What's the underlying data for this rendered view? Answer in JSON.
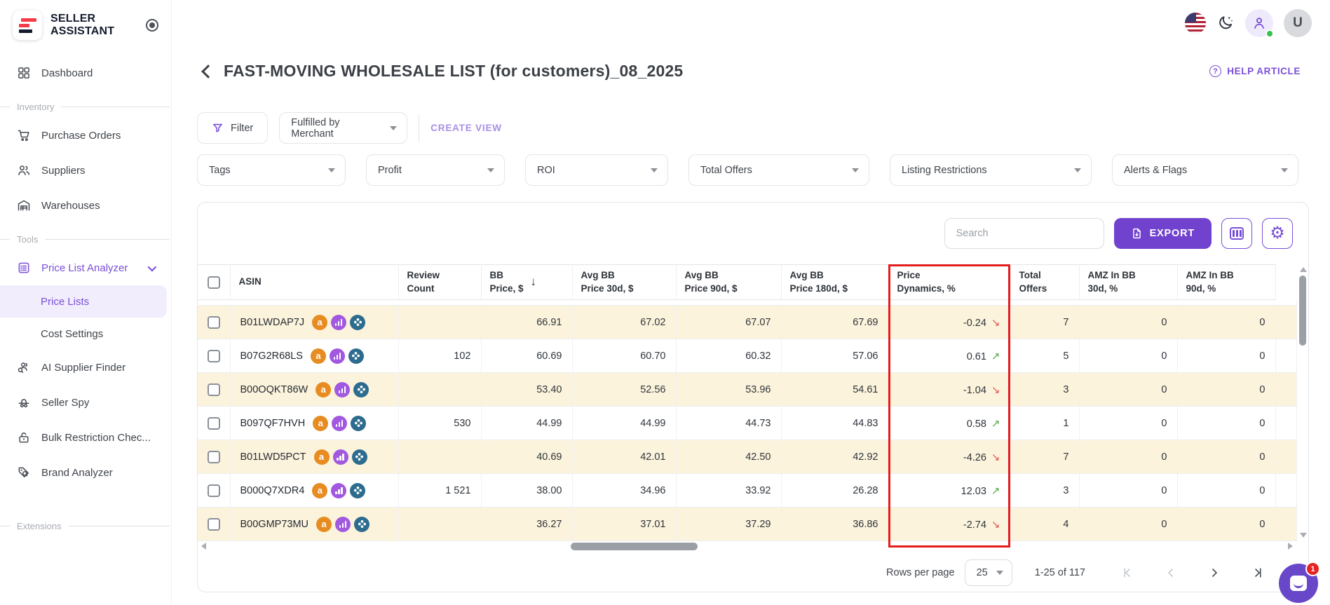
{
  "brand": {
    "line1": "SELLER",
    "line2": "ASSISTANT"
  },
  "topbar": {
    "avatar_letter": "U"
  },
  "sidebar": {
    "dashboard_label": "Dashboard",
    "inventory_label": "Inventory",
    "purchase_orders_label": "Purchase Orders",
    "suppliers_label": "Suppliers",
    "warehouses_label": "Warehouses",
    "tools_label": "Tools",
    "price_list_analyzer_label": "Price List Analyzer",
    "price_lists_label": "Price Lists",
    "cost_settings_label": "Cost Settings",
    "ai_supplier_finder_label": "AI Supplier Finder",
    "seller_spy_label": "Seller Spy",
    "bulk_restriction_label": "Bulk Restriction Chec...",
    "brand_analyzer_label": "Brand Analyzer",
    "extensions_label": "Extensions"
  },
  "page": {
    "title": "FAST-MOVING WHOLESALE LIST (for customers)_08_2025",
    "help_link": "HELP ARTICLE"
  },
  "filters": {
    "filter_button": "Filter",
    "view_select": "Fulfilled by Merchant",
    "create_view": "CREATE VIEW",
    "dropdowns": [
      "Tags",
      "Profit",
      "ROI",
      "Total Offers",
      "Listing Restrictions",
      "Alerts & Flags"
    ]
  },
  "toolbar": {
    "search_placeholder": "Search",
    "export_label": "EXPORT"
  },
  "table": {
    "columns": [
      {
        "key": "asin",
        "line1": "ASIN",
        "line2": ""
      },
      {
        "key": "review-count",
        "line1": "Review",
        "line2": "Count"
      },
      {
        "key": "bb-price",
        "line1": "BB",
        "line2": "Price, $",
        "sorted": true
      },
      {
        "key": "avg-bb-30d",
        "line1": "Avg BB",
        "line2": "Price 30d, $"
      },
      {
        "key": "avg-bb-90d",
        "line1": "Avg BB",
        "line2": "Price 90d, $"
      },
      {
        "key": "avg-bb-180d",
        "line1": "Avg BB",
        "line2": "Price 180d, $"
      },
      {
        "key": "price-dynamics",
        "line1": "Price",
        "line2": "Dynamics, %",
        "highlighted": true
      },
      {
        "key": "total-offers",
        "line1": "Total",
        "line2": "Offers"
      },
      {
        "key": "amz-in-bb-30d",
        "line1": "AMZ In BB",
        "line2": "30d, %"
      },
      {
        "key": "amz-in-bb-90d",
        "line1": "AMZ In BB",
        "line2": "90d, %"
      }
    ],
    "rows": [
      {
        "asin": "B01LWDAP7J",
        "review_count": "",
        "bb_price": "66.91",
        "avg_30d": "67.02",
        "avg_90d": "67.07",
        "avg_180d": "67.69",
        "price_dynamics": "-0.24",
        "trend": "down",
        "total_offers": "7",
        "amz_30d": "0",
        "amz_90d": "0"
      },
      {
        "asin": "B07G2R68LS",
        "review_count": "102",
        "bb_price": "60.69",
        "avg_30d": "60.70",
        "avg_90d": "60.32",
        "avg_180d": "57.06",
        "price_dynamics": "0.61",
        "trend": "up",
        "total_offers": "5",
        "amz_30d": "0",
        "amz_90d": "0"
      },
      {
        "asin": "B00OQKT86W",
        "review_count": "",
        "bb_price": "53.40",
        "avg_30d": "52.56",
        "avg_90d": "53.96",
        "avg_180d": "54.61",
        "price_dynamics": "-1.04",
        "trend": "down",
        "total_offers": "3",
        "amz_30d": "0",
        "amz_90d": "0"
      },
      {
        "asin": "B097QF7HVH",
        "review_count": "530",
        "bb_price": "44.99",
        "avg_30d": "44.99",
        "avg_90d": "44.73",
        "avg_180d": "44.83",
        "price_dynamics": "0.58",
        "trend": "up",
        "total_offers": "1",
        "amz_30d": "0",
        "amz_90d": "0"
      },
      {
        "asin": "B01LWD5PCT",
        "review_count": "",
        "bb_price": "40.69",
        "avg_30d": "42.01",
        "avg_90d": "42.50",
        "avg_180d": "42.92",
        "price_dynamics": "-4.26",
        "trend": "down",
        "total_offers": "7",
        "amz_30d": "0",
        "amz_90d": "0"
      },
      {
        "asin": "B000Q7XDR4",
        "review_count": "1 521",
        "bb_price": "38.00",
        "avg_30d": "34.96",
        "avg_90d": "33.92",
        "avg_180d": "26.28",
        "price_dynamics": "12.03",
        "trend": "up",
        "total_offers": "3",
        "amz_30d": "0",
        "amz_90d": "0"
      },
      {
        "asin": "B00GMP73MU",
        "review_count": "",
        "bb_price": "36.27",
        "avg_30d": "37.01",
        "avg_90d": "37.29",
        "avg_180d": "36.86",
        "price_dynamics": "-2.74",
        "trend": "down",
        "total_offers": "4",
        "amz_30d": "0",
        "amz_90d": "0"
      }
    ]
  },
  "pagination": {
    "rows_per_page_label": "Rows per page",
    "rows_per_page_value": "25",
    "range_label": "1-25 of 117"
  },
  "chat": {
    "badge": "1"
  },
  "icons": {
    "asin_row_icons": [
      "amazon-icon",
      "chart-icon",
      "keepa-icon"
    ],
    "trend_up_glyph": "↗",
    "trend_down_glyph": "↘",
    "sort_glyph": "↓"
  },
  "colors": {
    "accent_purple": "#7142ce",
    "light_purple": "#a98fe6",
    "row_highlight": "#fcf3dc",
    "highlight_border": "#e31e1e",
    "trend_up": "#53a93f",
    "trend_down": "#e2574c"
  }
}
